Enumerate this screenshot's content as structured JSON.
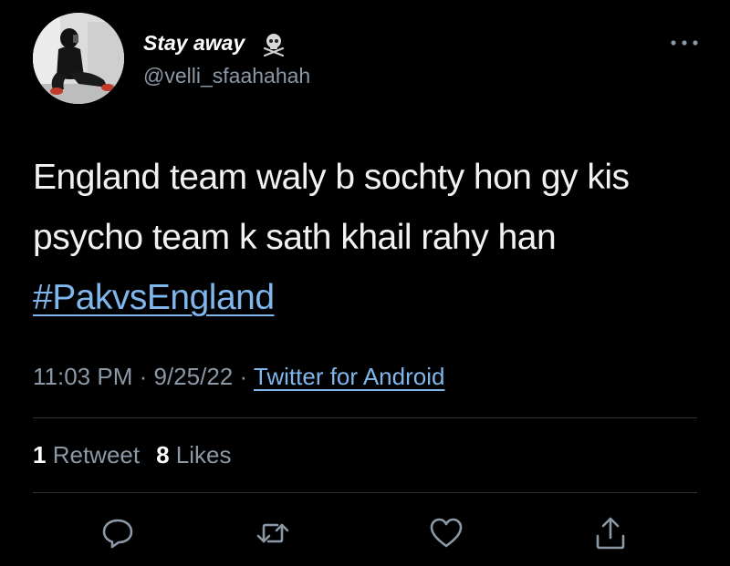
{
  "tweet": {
    "display_name": "Stay away",
    "name_emoji": "skull-crossbones-icon",
    "handle": "@velli_sfaahahah",
    "text_lines": [
      "England team waly b sochty hon gy kis",
      "psycho team k sath khail rahy han"
    ],
    "hashtag": "#PakvsEngland",
    "time": "11:03 PM",
    "separator": "·",
    "date": "9/25/22",
    "source": "Twitter for Android",
    "retweet_count": "1",
    "retweet_label": "Retweet",
    "like_count": "8",
    "like_label": "Likes"
  },
  "actions": [
    "reply-icon",
    "retweet-icon",
    "like-icon",
    "share-icon"
  ],
  "colors": {
    "background": "#000000",
    "text": "#e7e9ea",
    "secondary": "#8b98a5",
    "link": "#7fb6ec",
    "divider": "#2f3336"
  }
}
